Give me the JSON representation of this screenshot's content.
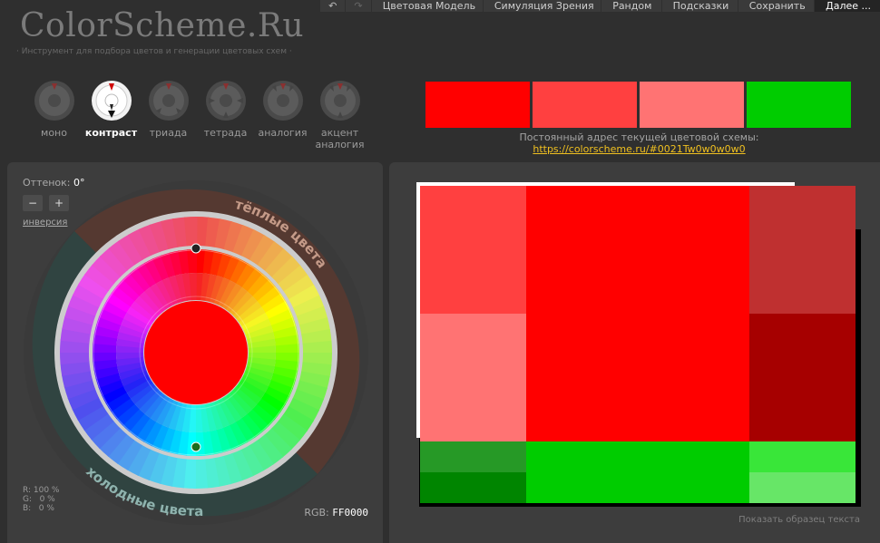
{
  "menu": [
    "↶",
    "↷",
    "Цветовая Модель",
    "Симуляция Зрения",
    "Рандом",
    "Подсказки",
    "Сохранить",
    "Далее ..."
  ],
  "header": {
    "logo": "ColorScheme.Ru",
    "tagline": "· Инструмент для подбора цветов и генерации цветовых схем ·"
  },
  "modes": [
    {
      "label": "моно"
    },
    {
      "label": "контраст",
      "active": true
    },
    {
      "label": "триада"
    },
    {
      "label": "тетрада"
    },
    {
      "label": "аналогия"
    },
    {
      "label": "акцент аналогия"
    }
  ],
  "swatches": [
    "#FF0000",
    "#FF4040",
    "#FF7373",
    "#00CC00"
  ],
  "permalink": {
    "label": "Постоянный адрес текущей цветовой схемы:",
    "url": "https://colorscheme.ru/#0021Tw0w0w0w0"
  },
  "controls": {
    "hue_label": "Оттенок:",
    "hue_value": "0°",
    "minus": "−",
    "plus": "+",
    "invert": "инверсия"
  },
  "wheel": {
    "warm_label": "тёплые цвета",
    "cold_label": "холодные цвета",
    "center_color": "#FF0000"
  },
  "rgb": {
    "r": "R: 100 %",
    "g": "G:   0 %",
    "b": "B:   0 %",
    "label": "RGB:",
    "hex": "FF0000"
  },
  "preview": {
    "primary": {
      "main": "#FF0000",
      "light1": "#FF4040",
      "light2": "#FF7373",
      "dark1": "#BF3030",
      "dark2": "#A60000"
    },
    "complement": {
      "main": "#00CC00",
      "light1": "#39E639",
      "light2": "#67E667",
      "dark1": "#269926",
      "dark2": "#008500"
    },
    "sample_text": "Показать образец текста"
  }
}
